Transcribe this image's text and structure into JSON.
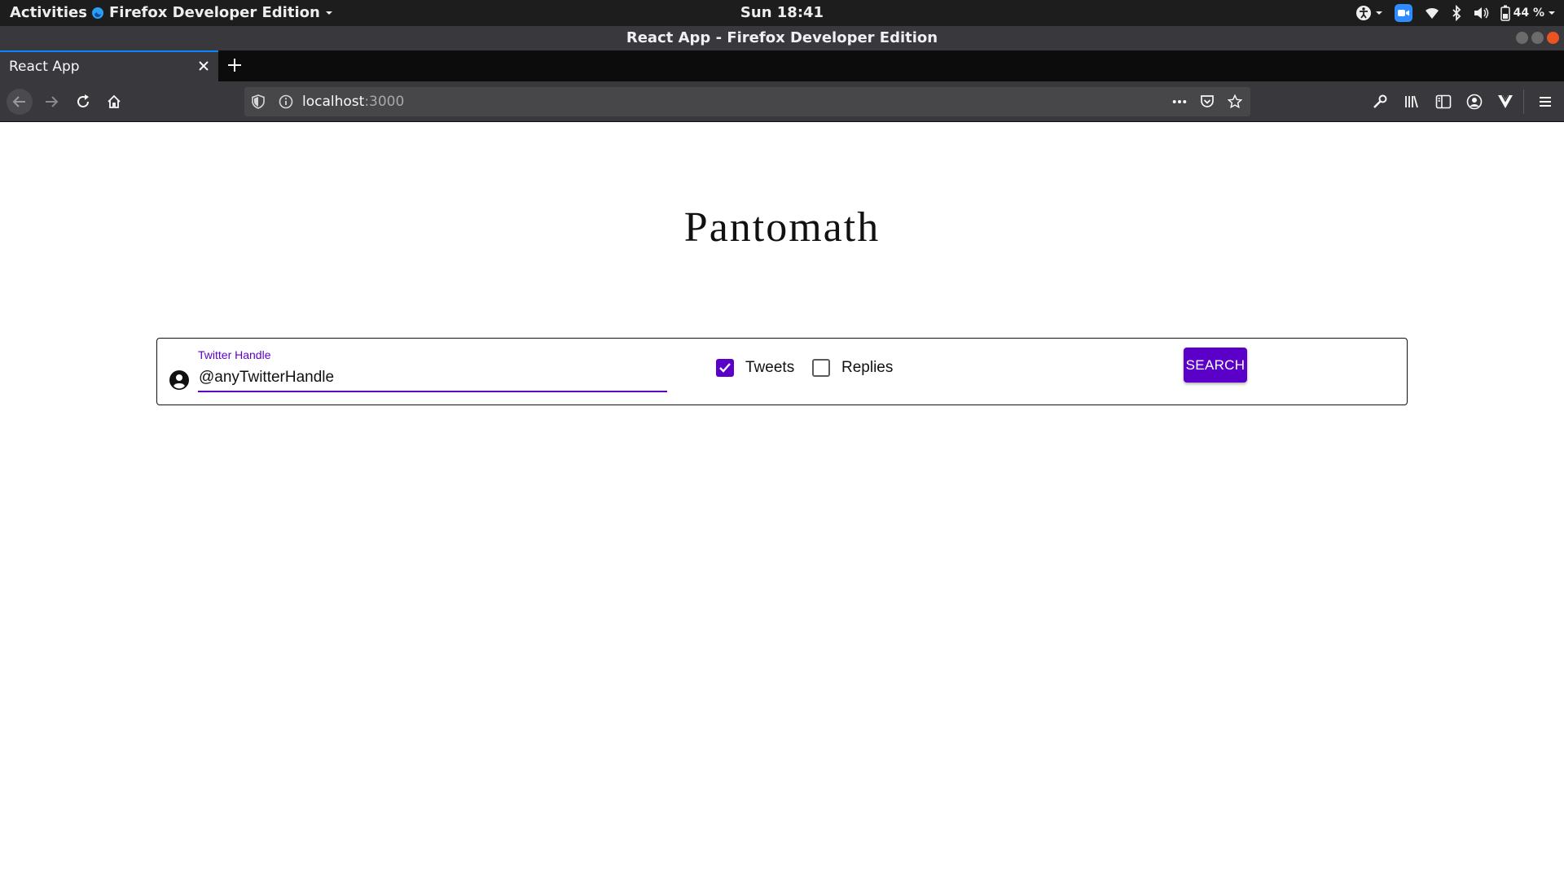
{
  "os_bar": {
    "activities": "Activities",
    "app_name": "Firefox Developer Edition",
    "clock": "Sun 18:41",
    "battery": "44 %"
  },
  "window": {
    "title": "React App - Firefox Developer Edition"
  },
  "tabs": [
    {
      "label": "React App",
      "active": true
    }
  ],
  "address_bar": {
    "host": "localhost",
    "port": ":3000"
  },
  "page": {
    "logo": "Pantomath",
    "handle_field": {
      "label": "Twitter Handle",
      "value": "@anyTwitterHandle"
    },
    "filters": [
      {
        "label": "Tweets",
        "checked": true
      },
      {
        "label": "Replies",
        "checked": false
      }
    ],
    "search_label": "SEARCH"
  },
  "colors": {
    "accent": "#5b00c9",
    "browser_chrome": "#38383d",
    "tab_highlight": "#0a84ff"
  }
}
